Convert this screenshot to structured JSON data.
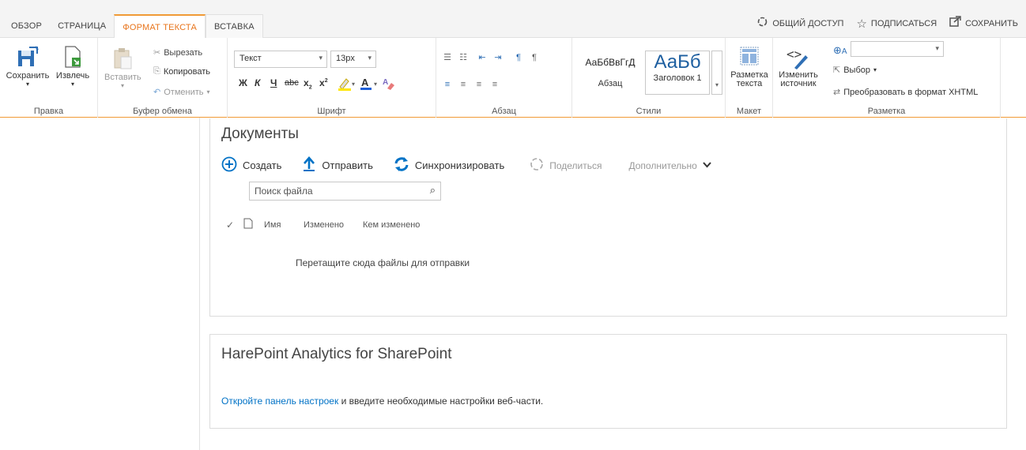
{
  "tabs": [
    {
      "label": "ОБЗОР"
    },
    {
      "label": "СТРАНИЦА"
    },
    {
      "label": "ФОРМАТ ТЕКСТА"
    },
    {
      "label": "ВСТАВКА"
    }
  ],
  "top_actions": {
    "share": "ОБЩИЙ ДОСТУП",
    "follow": "ПОДПИСАТЬСЯ",
    "save": "СОХРАНИТЬ"
  },
  "ribbon": {
    "edit": {
      "title": "Правка",
      "save": "Сохранить",
      "checkout": "Извлечь"
    },
    "clipboard": {
      "title": "Буфер обмена",
      "paste": "Вставить",
      "cut": "Вырезать",
      "copy": "Копировать",
      "undo": "Отменить"
    },
    "font": {
      "title": "Шрифт",
      "family": "Текст",
      "size": "13px"
    },
    "paragraph": {
      "title": "Абзац"
    },
    "styles": {
      "title": "Стили",
      "style1_preview": "АаБбВвГгД",
      "style1_name": "Абзац",
      "style2_preview": "АаБб",
      "style2_name": "Заголовок 1"
    },
    "layout": {
      "title": "Макет",
      "button": "Разметка текста"
    },
    "markup": {
      "title": "Разметка",
      "edit_source": "Изменить источник",
      "select": "Выбор",
      "convert": "Преобразовать в формат XHTML",
      "lang_value": ""
    }
  },
  "documents": {
    "title": "Документы",
    "toolbar": {
      "create": "Создать",
      "upload": "Отправить",
      "sync": "Синхронизировать",
      "share": "Поделиться",
      "more": "Дополнительно"
    },
    "search_placeholder": "Поиск файла",
    "columns": {
      "name": "Имя",
      "modified": "Изменено",
      "modified_by": "Кем изменено"
    },
    "drop_message": "Перетащите сюда файлы для отправки"
  },
  "analytics": {
    "title": "HarePoint Analytics for SharePoint",
    "link_text": "Откройте панель настроек",
    "rest_text": " и введите необходимые настройки веб-части."
  },
  "colors": {
    "accent": "#f09a36",
    "link": "#0072c6",
    "blue_icon": "#0072c6"
  }
}
